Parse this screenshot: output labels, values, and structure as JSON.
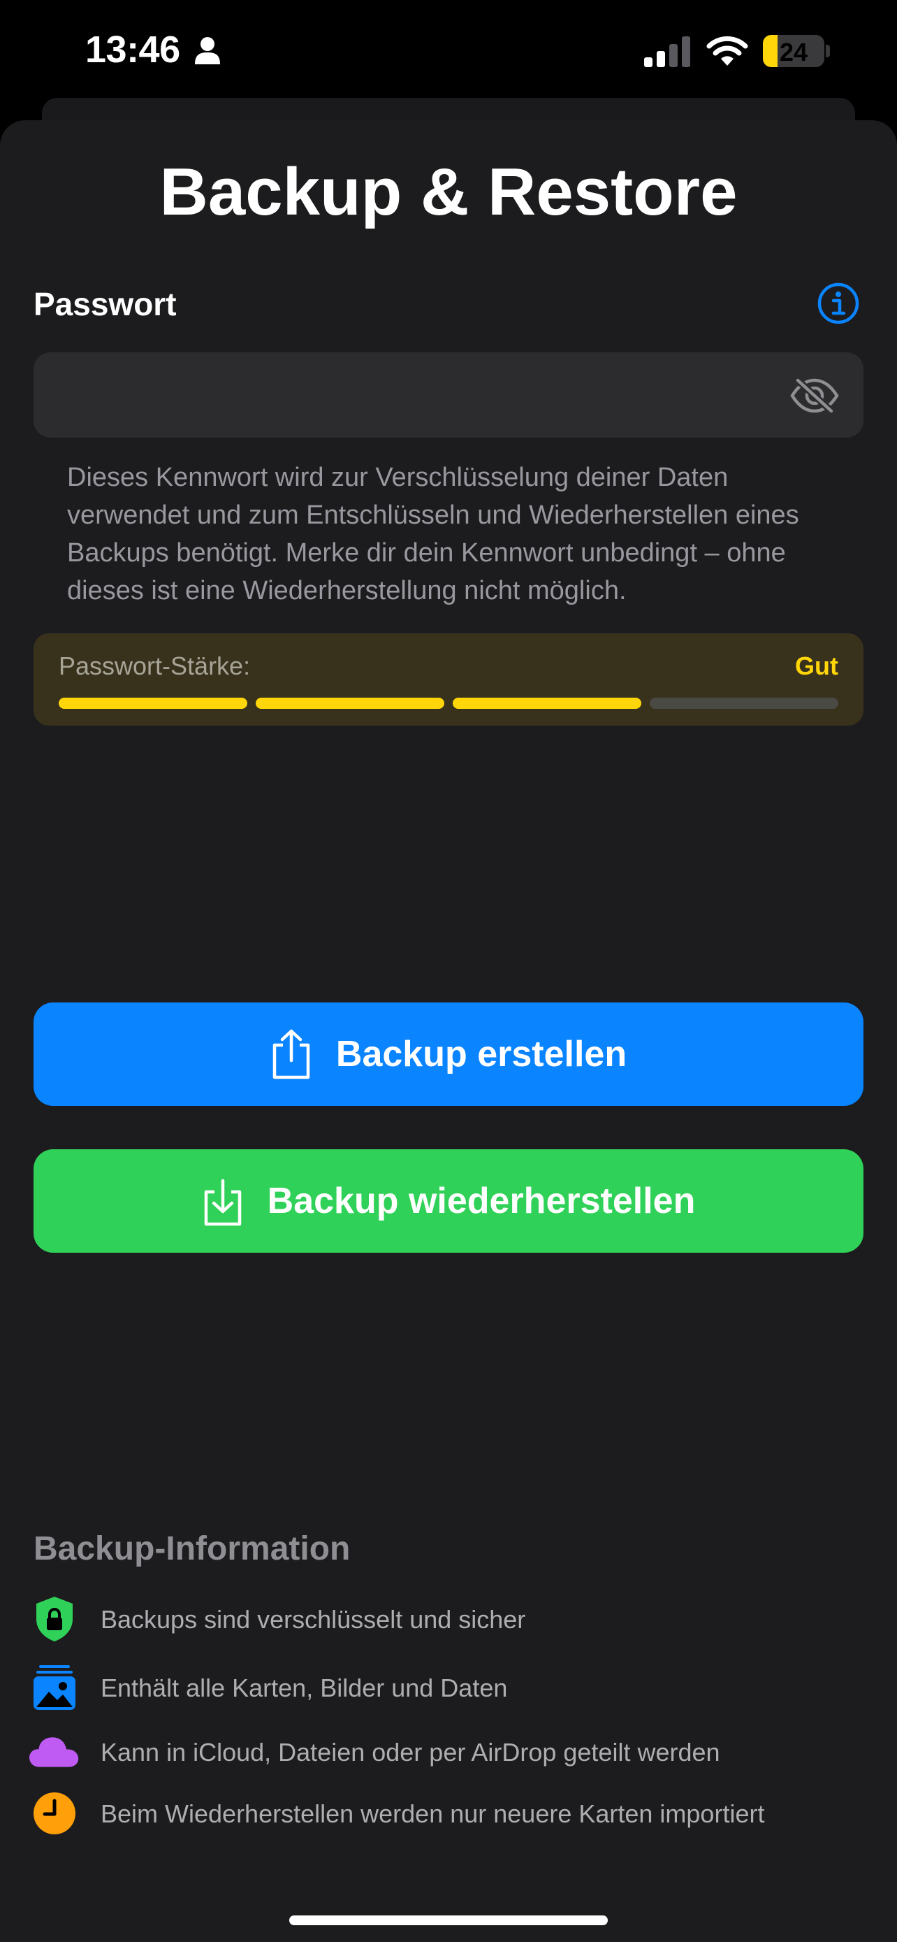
{
  "status_bar": {
    "time": "13:46",
    "battery_percent": "24",
    "battery_level": 0.24,
    "battery_color": "#ffd60a"
  },
  "page": {
    "title": "Backup & Restore"
  },
  "password": {
    "label": "Passwort",
    "value": "",
    "placeholder": "",
    "info_icon": "info-circle-icon",
    "visibility_icon": "eye-slash-icon",
    "hint": "Dieses Kennwort wird zur Verschlüsselung deiner Daten verwendet und zum Entschlüsseln und Wiederherstellen eines Backups benötigt. Merke dir dein Kennwort unbedingt – ohne dieses ist eine Wiederherstellung nicht möglich."
  },
  "strength": {
    "label": "Passwort-Stärke:",
    "value": "Gut",
    "level": 3,
    "max_level": 4,
    "active_color": "#ffd60a",
    "inactive_color": "#4a4a44"
  },
  "actions": {
    "backup_label": "Backup erstellen",
    "backup_icon": "share-upload-icon",
    "backup_color": "#0a84ff",
    "restore_label": "Backup wiederherstellen",
    "restore_icon": "download-tray-icon",
    "restore_color": "#30d158"
  },
  "info_section": {
    "title": "Backup-Information",
    "items": [
      {
        "icon": "lock-shield-icon",
        "text": "Backups sind verschlüsselt und sicher"
      },
      {
        "icon": "photo-stack-icon",
        "text": "Enthält alle Karten, Bilder und Daten"
      },
      {
        "icon": "cloud-icon",
        "text": "Kann in iCloud, Dateien oder per AirDrop geteilt werden"
      },
      {
        "icon": "clock-icon",
        "text": "Beim Wiederherstellen werden nur neuere Karten importiert"
      }
    ]
  }
}
